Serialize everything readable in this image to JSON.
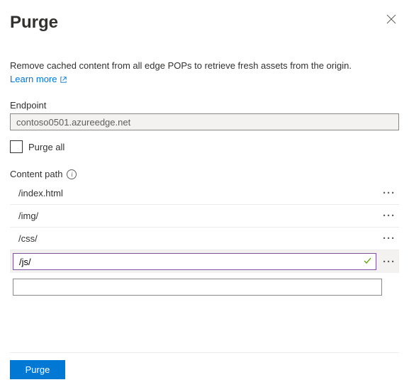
{
  "header": {
    "title": "Purge"
  },
  "description": "Remove cached content from all edge POPs to retrieve fresh assets from the origin.",
  "learn_more": "Learn more",
  "endpoint": {
    "label": "Endpoint",
    "value": "contoso0501.azureedge.net"
  },
  "purge_all": {
    "label": "Purge all",
    "checked": false
  },
  "content_path": {
    "label": "Content path",
    "rows": [
      {
        "value": "/index.html"
      },
      {
        "value": "/img/"
      },
      {
        "value": "/css/"
      }
    ],
    "active": {
      "value": "/js/"
    },
    "empty": {
      "value": ""
    }
  },
  "footer": {
    "purge_button": "Purge"
  }
}
